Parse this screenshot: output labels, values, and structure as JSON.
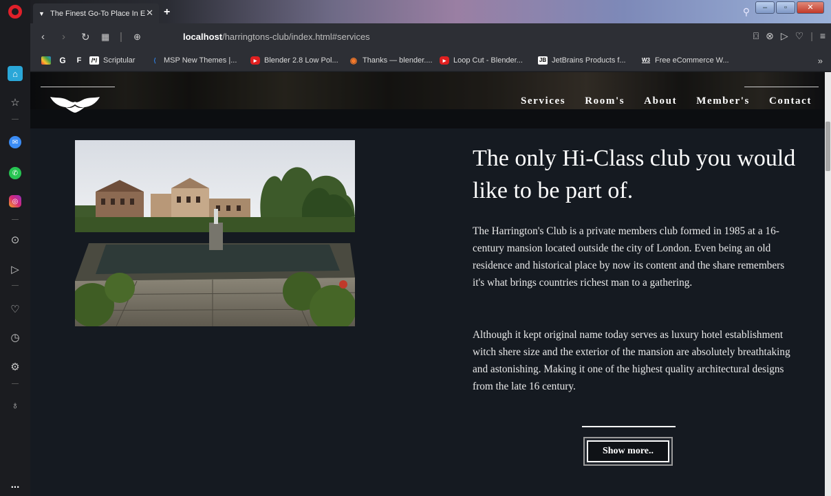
{
  "browser": {
    "tab_title": "The Finest Go-To Place In E",
    "new_tab": "+",
    "url_host": "localhost",
    "url_path": "/harringtons-club/index.html#services",
    "bookmarks": [
      {
        "label": "Scriptular",
        "icon": "scriptular-icon",
        "color": "#ffffff"
      },
      {
        "label": "MSP New Themes |...",
        "icon": "msp-icon",
        "color": "#2f7fe0"
      },
      {
        "label": "Blender 2.8 Low Pol...",
        "icon": "youtube-icon",
        "color": "#e02020"
      },
      {
        "label": "Thanks — blender....",
        "icon": "blender-icon",
        "color": "#f5792a"
      },
      {
        "label": "Loop Cut - Blender...",
        "icon": "youtube-icon",
        "color": "#e02020"
      },
      {
        "label": "JetBrains Products f...",
        "icon": "jetbrains-icon",
        "color": "#000000"
      },
      {
        "label": "Free eCommerce W...",
        "icon": "w3schools-icon",
        "color": "#4caf50"
      }
    ],
    "bookmark_small_icons": [
      "F"
    ],
    "more": "»"
  },
  "site": {
    "nav": [
      "Services",
      "Room's",
      "About",
      "Member's",
      "Contact"
    ],
    "headline": "The only Hi-Class club you would like to be part of.",
    "paragraph1": "The Harrington's Club is a private members club formed in 1985 at a 16-century mansion located outside the city of London. Even being an old residence and historical place by now its content and the share remembers it's what brings countries richest man to a gathering.",
    "paragraph2": "Although it kept original name today serves as luxury hotel establishment witch shere size and the exterior of the mansion are absolutely breathtaking and astonishing. Making it one of the highest quality architectural designs from the late 16 century.",
    "button": "Show more.."
  },
  "sidebar_more": "..."
}
